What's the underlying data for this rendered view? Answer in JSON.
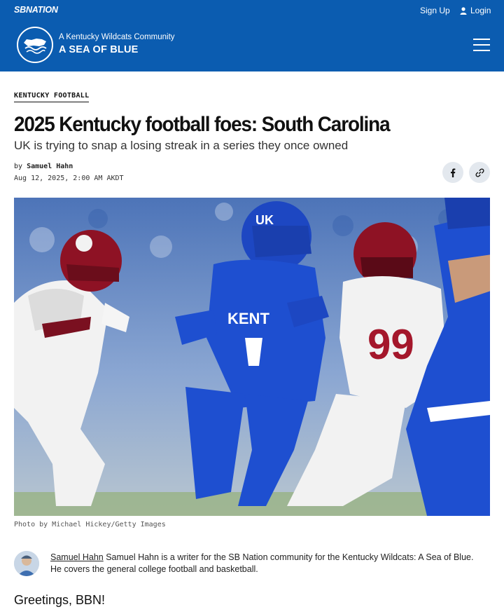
{
  "header": {
    "network_logo": "SBNATION",
    "signup_label": "Sign Up",
    "login_label": "Login",
    "community_subtitle": "A Kentucky Wildcats Community",
    "site_title": "A SEA OF BLUE"
  },
  "article": {
    "category": "KENTUCKY FOOTBALL",
    "headline": "2025 Kentucky football foes: South Carolina",
    "dek": "UK is trying to snap a losing streak in a series they once owned",
    "by_prefix": "by",
    "author": "Samuel Hahn",
    "date": "Aug 12, 2025, 2:00 AM AKDT",
    "photo_caption": "Photo by Michael Hickey/Getty Images",
    "hero_jersey_text": "KENT",
    "hero_number_opponent": "99",
    "greeting": "Greetings, BBN!"
  },
  "bio": {
    "name": "Samuel Hahn",
    "text": " Samuel Hahn is a writer for the SB Nation community for the Kentucky Wildcats: A Sea of Blue. He covers the general college football and basketball."
  },
  "icons": {
    "user": "user-icon",
    "menu": "hamburger-menu-icon",
    "facebook": "facebook-icon",
    "link": "link-icon",
    "logo": "sea-of-blue-logo"
  },
  "colors": {
    "brand_blue": "#0b5cb0",
    "share_bg": "#e3e8ee"
  }
}
